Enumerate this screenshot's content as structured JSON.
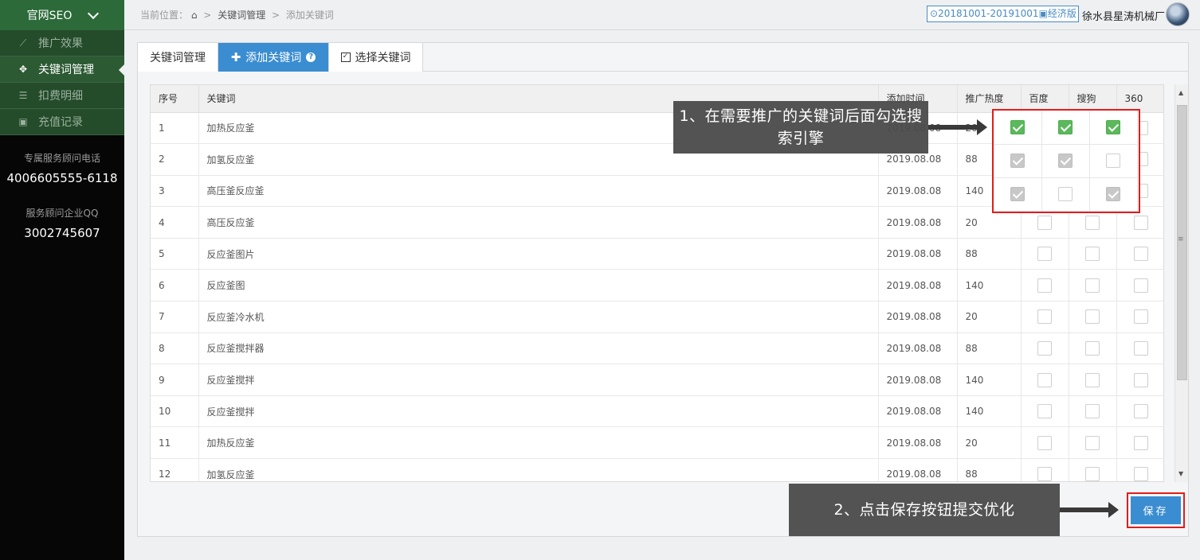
{
  "sidebar": {
    "brand": "官网SEO",
    "items": [
      {
        "label": "推广效果",
        "icon": "chart-line-icon",
        "glyph": "📈"
      },
      {
        "label": "关键词管理",
        "icon": "crosshair-icon",
        "glyph": "✥"
      },
      {
        "label": "扣费明细",
        "icon": "list-icon",
        "glyph": "☰"
      },
      {
        "label": "充值记录",
        "icon": "money-icon",
        "glyph": "▣"
      }
    ],
    "phone_label": "专属服务顾问电话",
    "phone": "4006605555-6118",
    "qq_label": "服务顾问企业QQ",
    "qq": "3002745607"
  },
  "topbar": {
    "crumb_prefix": "当前位置：",
    "home_icon": "home-icon",
    "crumb_sep": ">",
    "crumb_1": "关键词管理",
    "crumb_2": "添加关键词",
    "plan_date": "20181001-20191001",
    "plan_name": "经济版",
    "company": "徐水县星涛机械厂"
  },
  "tabs": [
    {
      "label": "关键词管理"
    },
    {
      "label": "添加关键词"
    },
    {
      "label": "选择关键词"
    }
  ],
  "table": {
    "headers": [
      "序号",
      "关键词",
      "添加时间",
      "推广热度",
      "百度",
      "搜狗",
      "360"
    ],
    "rows": [
      {
        "no": "1",
        "kw": "加热反应釜",
        "date": "2019.08.08",
        "heat": "20"
      },
      {
        "no": "2",
        "kw": "加氢反应釜",
        "date": "2019.08.08",
        "heat": "88"
      },
      {
        "no": "3",
        "kw": "高压釜反应釜",
        "date": "2019.08.08",
        "heat": "140"
      },
      {
        "no": "4",
        "kw": "高压反应釜",
        "date": "2019.08.08",
        "heat": "20"
      },
      {
        "no": "5",
        "kw": "反应釜图片",
        "date": "2019.08.08",
        "heat": "88"
      },
      {
        "no": "6",
        "kw": "反应釜图",
        "date": "2019.08.08",
        "heat": "140"
      },
      {
        "no": "7",
        "kw": "反应釜冷水机",
        "date": "2019.08.08",
        "heat": "20"
      },
      {
        "no": "8",
        "kw": "反应釜搅拌器",
        "date": "2019.08.08",
        "heat": "88"
      },
      {
        "no": "9",
        "kw": "反应釜搅拌",
        "date": "2019.08.08",
        "heat": "140"
      },
      {
        "no": "10",
        "kw": "反应釜搅拌",
        "date": "2019.08.08",
        "heat": "140"
      },
      {
        "no": "11",
        "kw": "加热反应釜",
        "date": "2019.08.08",
        "heat": "20"
      },
      {
        "no": "12",
        "kw": "加氢反应釜",
        "date": "2019.08.08",
        "heat": "88"
      }
    ]
  },
  "callouts": {
    "step1": "1、在需要推广的关键词后面勾选搜索引擎",
    "step2": "2、点击保存按钮提交优化"
  },
  "save_label": "保存",
  "colors": {
    "sidebar_green": "#2c6b39",
    "accent_blue": "#3b8dd1",
    "highlight_red": "#e31c1c",
    "check_green": "#5cb85c"
  }
}
